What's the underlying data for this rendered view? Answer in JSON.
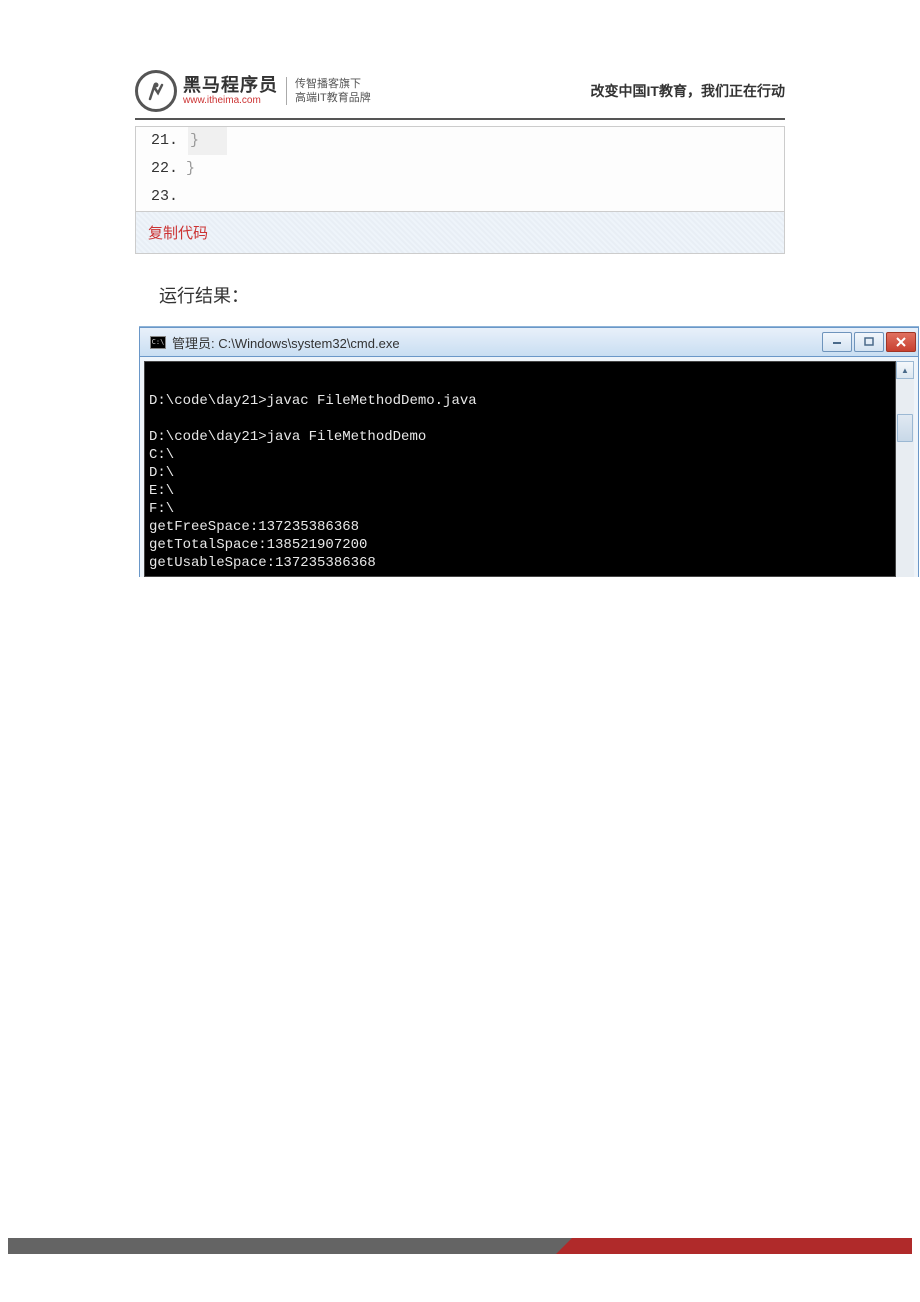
{
  "header": {
    "logo_main": "黑马程序员",
    "logo_sub": "www.itheima.com",
    "slogan_line1": "传智播客旗下",
    "slogan_line2": "高端IT教育品牌",
    "right_text": "改变中国IT教育，我们正在行动"
  },
  "code": {
    "lines": [
      {
        "num": "21.",
        "content": "}",
        "highlight": true
      },
      {
        "num": "22.",
        "content": "}",
        "highlight": false
      },
      {
        "num": "23.",
        "content": "",
        "highlight": false
      }
    ],
    "copy_label": "复制代码"
  },
  "result_label": "运行结果：",
  "cmd": {
    "title": "管理员: C:\\Windows\\system32\\cmd.exe",
    "output": "\nD:\\code\\day21>javac FileMethodDemo.java\n\nD:\\code\\day21>java FileMethodDemo\nC:\\\nD:\\\nE:\\\nF:\\\ngetFreeSpace:137235386368\ngetTotalSpace:138521907200\ngetUsableSpace:137235386368"
  }
}
